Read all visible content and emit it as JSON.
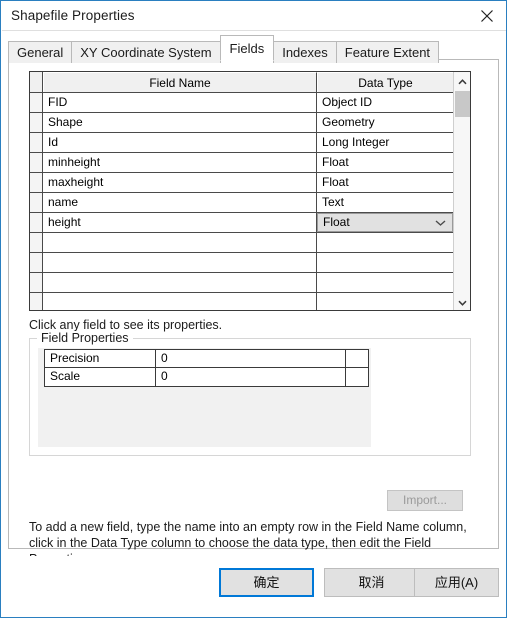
{
  "window": {
    "title": "Shapefile Properties",
    "close_icon": "close-icon",
    "accent_color": "#2a7fc0"
  },
  "tabs": [
    {
      "label": "General",
      "active": false
    },
    {
      "label": "XY Coordinate System",
      "active": false
    },
    {
      "label": "Fields",
      "active": true
    },
    {
      "label": "Indexes",
      "active": false
    },
    {
      "label": "Feature Extent",
      "active": false
    }
  ],
  "field_grid": {
    "columns": [
      "Field Name",
      "Data Type"
    ],
    "rows": [
      {
        "name": "FID",
        "type": "Object ID",
        "dropdown": false
      },
      {
        "name": "Shape",
        "type": "Geometry",
        "dropdown": false
      },
      {
        "name": "Id",
        "type": "Long Integer",
        "dropdown": false
      },
      {
        "name": "minheight",
        "type": "Float",
        "dropdown": false
      },
      {
        "name": "maxheight",
        "type": "Float",
        "dropdown": false
      },
      {
        "name": "name",
        "type": "Text",
        "dropdown": false
      },
      {
        "name": "height",
        "type": "Float",
        "dropdown": true
      },
      {
        "name": "",
        "type": "",
        "dropdown": false
      },
      {
        "name": "",
        "type": "",
        "dropdown": false
      },
      {
        "name": "",
        "type": "",
        "dropdown": false
      },
      {
        "name": "",
        "type": "",
        "dropdown": false
      },
      {
        "name": "",
        "type": "",
        "dropdown": false
      },
      {
        "name": "",
        "type": "",
        "dropdown": false
      }
    ],
    "scrollbar": {
      "up_icon": "chevron-up-icon",
      "down_icon": "chevron-down-icon"
    },
    "dropdown_icon": "chevron-down-icon"
  },
  "hints": {
    "click_field": "Click any field to see its properties.",
    "add_field": "To add a new field, type the name into an empty row in the Field Name column, click in the Data Type column to choose the data type, then edit the Field Properties."
  },
  "field_properties": {
    "legend": "Field Properties",
    "rows": [
      {
        "key": "Precision",
        "value": "0"
      },
      {
        "key": "Scale",
        "value": "0"
      }
    ],
    "import_label": "Import...",
    "import_enabled": false
  },
  "footer": {
    "ok_label": "确定",
    "cancel_label": "取消",
    "apply_label": "应用(A)"
  }
}
